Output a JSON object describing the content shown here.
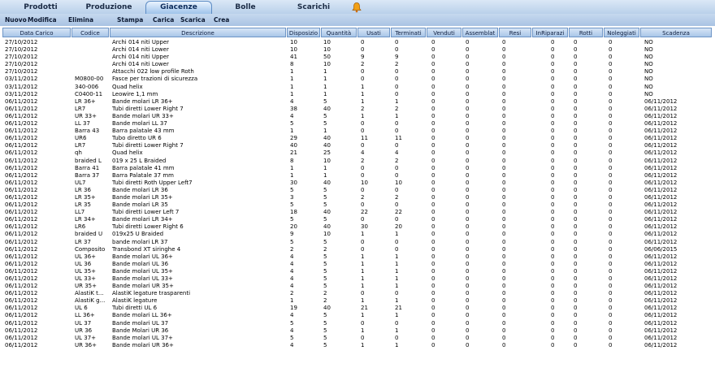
{
  "tabs": [
    "Prodotti",
    "Produzione",
    "Giacenze",
    "Bolle",
    "Scarichi"
  ],
  "active_tab": "Giacenze",
  "toolbar": [
    "Nuovo",
    "Modifica",
    "Elimina",
    "Stampa",
    "Carica",
    "Scarica",
    "Crea"
  ],
  "columns": [
    "Data Carico",
    "Codice",
    "Descrizione",
    "Disposizio",
    "Quantità",
    "Usati",
    "Terminati",
    "Venduti",
    "Assemblat",
    "Resi",
    "InRiparazi",
    "Rotti",
    "Noleggiati",
    "Scadenza"
  ],
  "rows": [
    [
      "27/10/2012",
      "",
      "Archi 014 niti Upper",
      "10",
      "10",
      "0",
      "0",
      "0",
      "0",
      "0",
      "0",
      "0",
      "0",
      "NO"
    ],
    [
      "27/10/2012",
      "",
      "Archi 014 niti Lower",
      "10",
      "10",
      "0",
      "0",
      "0",
      "0",
      "0",
      "0",
      "0",
      "0",
      "NO"
    ],
    [
      "27/10/2012",
      "",
      "Archi 014 niti Upper",
      "41",
      "50",
      "9",
      "9",
      "0",
      "0",
      "0",
      "0",
      "0",
      "0",
      "NO"
    ],
    [
      "27/10/2012",
      "",
      "Archi 014 niti Lower",
      "8",
      "10",
      "2",
      "2",
      "0",
      "0",
      "0",
      "0",
      "0",
      "0",
      "NO"
    ],
    [
      "27/10/2012",
      "",
      "Attacchi 022 low profile Roth",
      "1",
      "1",
      "0",
      "0",
      "0",
      "0",
      "0",
      "0",
      "0",
      "0",
      "NO"
    ],
    [
      "03/11/2012",
      "M0800-00",
      "Fasce per trazioni di sicurezza",
      "1",
      "1",
      "0",
      "0",
      "0",
      "0",
      "0",
      "0",
      "0",
      "0",
      "NO"
    ],
    [
      "03/11/2012",
      "340-006",
      "Quad helix",
      "1",
      "1",
      "1",
      "0",
      "0",
      "0",
      "0",
      "0",
      "0",
      "0",
      "NO"
    ],
    [
      "03/11/2012",
      "C0400-11",
      "Leowire 1,1 mm",
      "1",
      "1",
      "1",
      "0",
      "0",
      "0",
      "0",
      "0",
      "0",
      "0",
      "NO"
    ],
    [
      "06/11/2012",
      "LR 36+",
      "Bande molari LR 36+",
      "4",
      "5",
      "1",
      "1",
      "0",
      "0",
      "0",
      "0",
      "0",
      "0",
      "06/11/2012"
    ],
    [
      "06/11/2012",
      "LR7",
      "Tubi diretti Lower Right 7",
      "38",
      "40",
      "2",
      "2",
      "0",
      "0",
      "0",
      "0",
      "0",
      "0",
      "06/11/2012"
    ],
    [
      "06/11/2012",
      "UR 33+",
      "Bande molari UR 33+",
      "4",
      "5",
      "1",
      "1",
      "0",
      "0",
      "0",
      "0",
      "0",
      "0",
      "06/11/2012"
    ],
    [
      "06/11/2012",
      "LL 37",
      "Bande molari LL 37",
      "5",
      "5",
      "0",
      "0",
      "0",
      "0",
      "0",
      "0",
      "0",
      "0",
      "06/11/2012"
    ],
    [
      "06/11/2012",
      "Barra 43",
      "Barra palatale 43 mm",
      "1",
      "1",
      "0",
      "0",
      "0",
      "0",
      "0",
      "0",
      "0",
      "0",
      "06/11/2012"
    ],
    [
      "06/11/2012",
      "UR6",
      "Tubo diretto UR 6",
      "29",
      "40",
      "11",
      "11",
      "0",
      "0",
      "0",
      "0",
      "0",
      "0",
      "06/11/2012"
    ],
    [
      "06/11/2012",
      "LR7",
      "Tubi diretti Lower Right 7",
      "40",
      "40",
      "0",
      "0",
      "0",
      "0",
      "0",
      "0",
      "0",
      "0",
      "06/11/2012"
    ],
    [
      "06/11/2012",
      "qh",
      "Quad helix",
      "21",
      "25",
      "4",
      "4",
      "0",
      "0",
      "0",
      "0",
      "0",
      "0",
      "06/11/2012"
    ],
    [
      "06/11/2012",
      "braided L",
      "019 x 25 L Braided",
      "8",
      "10",
      "2",
      "2",
      "0",
      "0",
      "0",
      "0",
      "0",
      "0",
      "06/11/2012"
    ],
    [
      "06/11/2012",
      "Barra 41",
      "Barra palatale 41 mm",
      "1",
      "1",
      "0",
      "0",
      "0",
      "0",
      "0",
      "0",
      "0",
      "0",
      "06/11/2012"
    ],
    [
      "06/11/2012",
      "Barra 37",
      "Barra Palatale 37 mm",
      "1",
      "1",
      "0",
      "0",
      "0",
      "0",
      "0",
      "0",
      "0",
      "0",
      "06/11/2012"
    ],
    [
      "06/11/2012",
      "UL7",
      "Tubi diretti Roth Upper Left7",
      "30",
      "40",
      "10",
      "10",
      "0",
      "0",
      "0",
      "0",
      "0",
      "0",
      "06/11/2012"
    ],
    [
      "06/11/2012",
      "LR 36",
      "Bande molari LR 36",
      "5",
      "5",
      "0",
      "0",
      "0",
      "0",
      "0",
      "0",
      "0",
      "0",
      "06/11/2012"
    ],
    [
      "06/11/2012",
      "LR 35+",
      "Bande molari LR 35+",
      "3",
      "5",
      "2",
      "2",
      "0",
      "0",
      "0",
      "0",
      "0",
      "0",
      "06/11/2012"
    ],
    [
      "06/11/2012",
      "LR 35",
      "Bande molari LR 35",
      "5",
      "5",
      "0",
      "0",
      "0",
      "0",
      "0",
      "0",
      "0",
      "0",
      "06/11/2012"
    ],
    [
      "06/11/2012",
      "LL7",
      "Tubi diretti Lower Left 7",
      "18",
      "40",
      "22",
      "22",
      "0",
      "0",
      "0",
      "0",
      "0",
      "0",
      "06/11/2012"
    ],
    [
      "06/11/2012",
      "LR 34+",
      "Bande molari LR 34+",
      "5",
      "5",
      "0",
      "0",
      "0",
      "0",
      "0",
      "0",
      "0",
      "0",
      "06/11/2012"
    ],
    [
      "06/11/2012",
      "LR6",
      "Tubi diretti Lower Right 6",
      "20",
      "40",
      "30",
      "20",
      "0",
      "0",
      "0",
      "0",
      "0",
      "0",
      "06/11/2012"
    ],
    [
      "06/11/2012",
      "braided U",
      "019x25 U Braided",
      "9",
      "10",
      "1",
      "1",
      "0",
      "0",
      "0",
      "0",
      "0",
      "0",
      "06/11/2012"
    ],
    [
      "06/11/2012",
      "LR 37",
      "bande molari LR 37",
      "5",
      "5",
      "0",
      "0",
      "0",
      "0",
      "0",
      "0",
      "0",
      "0",
      "06/11/2012"
    ],
    [
      "06/11/2012",
      "Composito",
      "Transbond XT siringhe 4",
      "2",
      "2",
      "0",
      "0",
      "0",
      "0",
      "0",
      "0",
      "0",
      "0",
      "06/06/2015"
    ],
    [
      "06/11/2012",
      "UL 36+",
      "Bande molari UL 36+",
      "4",
      "5",
      "1",
      "1",
      "0",
      "0",
      "0",
      "0",
      "0",
      "0",
      "06/11/2012"
    ],
    [
      "06/11/2012",
      "UL 36",
      "Bande molari UL 36",
      "4",
      "5",
      "1",
      "1",
      "0",
      "0",
      "0",
      "0",
      "0",
      "0",
      "06/11/2012"
    ],
    [
      "06/11/2012",
      "UL 35+",
      "Bande molari UL 35+",
      "4",
      "5",
      "1",
      "1",
      "0",
      "0",
      "0",
      "0",
      "0",
      "0",
      "06/11/2012"
    ],
    [
      "06/11/2012",
      "UL 33+",
      "Bande molari UL 33+",
      "4",
      "5",
      "1",
      "1",
      "0",
      "0",
      "0",
      "0",
      "0",
      "0",
      "06/11/2012"
    ],
    [
      "06/11/2012",
      "UR 35+",
      "Bande molari UR 35+",
      "4",
      "5",
      "1",
      "1",
      "0",
      "0",
      "0",
      "0",
      "0",
      "0",
      "06/11/2012"
    ],
    [
      "06/11/2012",
      "AlastiK t...",
      "AlastiK legature trasparenti",
      "2",
      "2",
      "0",
      "0",
      "0",
      "0",
      "0",
      "0",
      "0",
      "0",
      "06/11/2012"
    ],
    [
      "06/11/2012",
      "AlastiK g...",
      "AlastiK legature",
      "1",
      "2",
      "1",
      "1",
      "0",
      "0",
      "0",
      "0",
      "0",
      "0",
      "06/11/2012"
    ],
    [
      "06/11/2012",
      "UL 6",
      "Tubi diretti UL 6",
      "19",
      "40",
      "21",
      "21",
      "0",
      "0",
      "0",
      "0",
      "0",
      "0",
      "06/11/2012"
    ],
    [
      "06/11/2012",
      "LL 36+",
      "Bande molari LL 36+",
      "4",
      "5",
      "1",
      "1",
      "0",
      "0",
      "0",
      "0",
      "0",
      "0",
      "06/11/2012"
    ],
    [
      "06/11/2012",
      "UL 37",
      "Bande molari UL 37",
      "5",
      "5",
      "0",
      "0",
      "0",
      "0",
      "0",
      "0",
      "0",
      "0",
      "06/11/2012"
    ],
    [
      "06/11/2012",
      "UR 36",
      "Bande Molari UR 36",
      "4",
      "5",
      "1",
      "1",
      "0",
      "0",
      "0",
      "0",
      "0",
      "0",
      "06/11/2012"
    ],
    [
      "06/11/2012",
      "UL 37+",
      "Bande molari UL 37+",
      "5",
      "5",
      "0",
      "0",
      "0",
      "0",
      "0",
      "0",
      "0",
      "0",
      "06/11/2012"
    ],
    [
      "06/11/2012",
      "UR 36+",
      "Bande molari UR 36+",
      "4",
      "5",
      "1",
      "1",
      "0",
      "0",
      "0",
      "0",
      "0",
      "0",
      "06/11/2012"
    ]
  ]
}
